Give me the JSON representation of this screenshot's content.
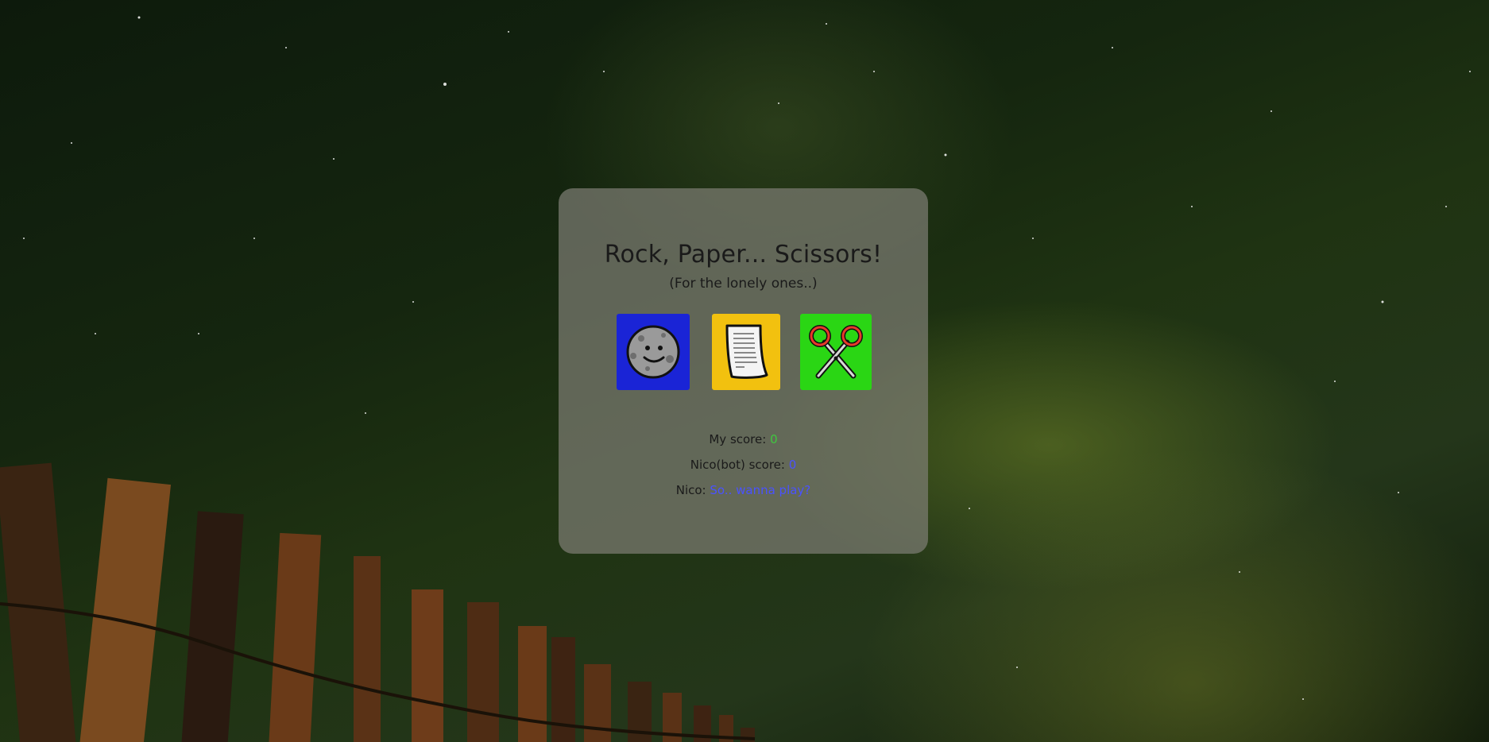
{
  "title": "Rock, Paper... Scissors!",
  "subtitle": "(For the lonely ones..)",
  "choices": [
    {
      "name": "rock",
      "icon": "moon-face-icon",
      "color": "#1a24d6"
    },
    {
      "name": "paper",
      "icon": "paper-scroll-icon",
      "color": "#f2c10f"
    },
    {
      "name": "scissors",
      "icon": "scissors-icon",
      "color": "#2ad614"
    }
  ],
  "scores": {
    "my_label": "My score:",
    "my_value": "0",
    "bot_label": "Nico(bot) score:",
    "bot_value": "0",
    "bot_name_label": "Nico:",
    "bot_message": "So.. wanna play?"
  }
}
